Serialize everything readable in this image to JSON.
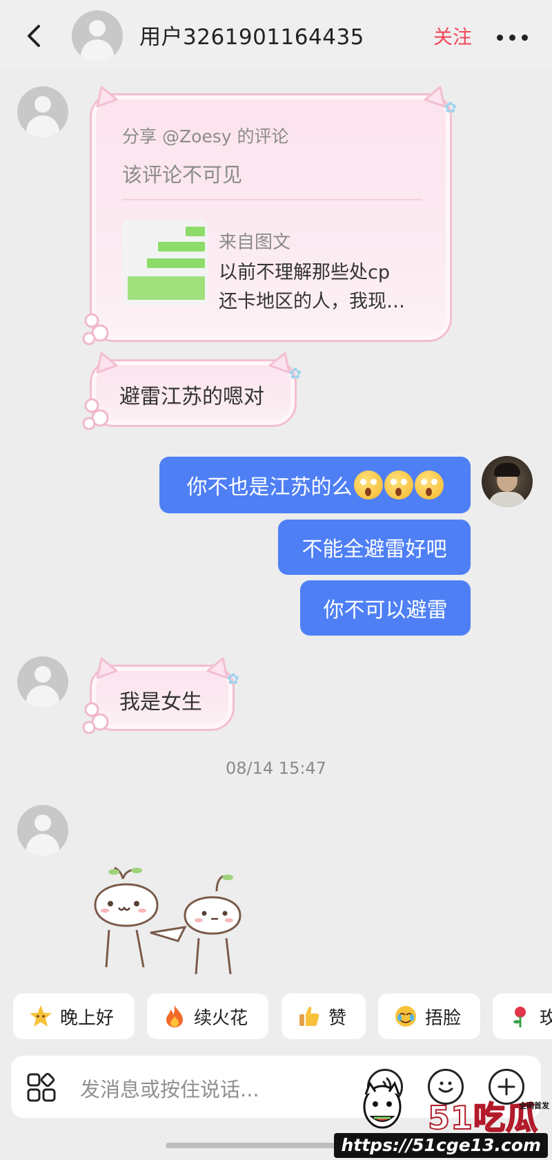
{
  "header": {
    "back_icon": "chevron-left-icon",
    "title": "用户3261901164435",
    "follow_label": "关注",
    "more_icon": "more-dots-icon"
  },
  "messages": {
    "shared": {
      "share_label": "分享 @Zoesy 的评论",
      "hidden_note": "该评论不可见",
      "from_label": "来自图文",
      "preview_line1": "以前不理解那些处cp",
      "preview_line2": "还卡地区的人，我现…"
    },
    "left_1": "避雷江苏的嗯对",
    "right_1": "你不也是江苏的么",
    "right_2": "不能全避雷好吧",
    "right_3": "你不可以避雷",
    "left_2": "我是女生",
    "timestamp": "08/14 15:47"
  },
  "quick_replies": [
    {
      "label": "晚上好",
      "icon": "star-icon"
    },
    {
      "label": "续火花",
      "icon": "fire-icon"
    },
    {
      "label": "赞",
      "icon": "thumbs-up-icon"
    },
    {
      "label": "捂脸",
      "icon": "facepalm-icon"
    },
    {
      "label": "玫",
      "icon": "rose-icon"
    }
  ],
  "input": {
    "placeholder": "发消息或按住说话..."
  },
  "watermark": {
    "logo": "51吃瓜",
    "tag": "全网首发",
    "url": "https://51cge13.com"
  },
  "colors": {
    "accent_follow": "#f2475c",
    "my_bubble": "#4e7ff5",
    "pink_bubble_border": "#f3bed2"
  }
}
